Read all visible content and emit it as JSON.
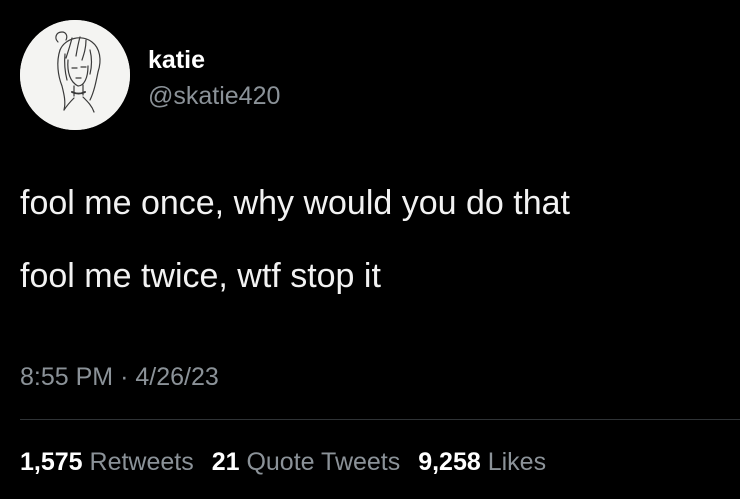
{
  "author": {
    "display_name": "katie",
    "handle": "@skatie420",
    "avatar_icon": "sketch-portrait-avatar"
  },
  "tweet": {
    "lines": [
      "fool me once, why would you do that",
      "fool me twice, wtf stop it"
    ],
    "time": "8:55 PM",
    "separator": "·",
    "date": "4/26/23"
  },
  "stats": {
    "retweets_count": "1,575",
    "retweets_label": "Retweets",
    "quotes_count": "21",
    "quotes_label": "Quote Tweets",
    "likes_count": "9,258",
    "likes_label": "Likes"
  },
  "colors": {
    "background": "#000000",
    "primary_text": "#e7e9ea",
    "secondary_text": "#8b9298",
    "divider": "#2f3336"
  }
}
